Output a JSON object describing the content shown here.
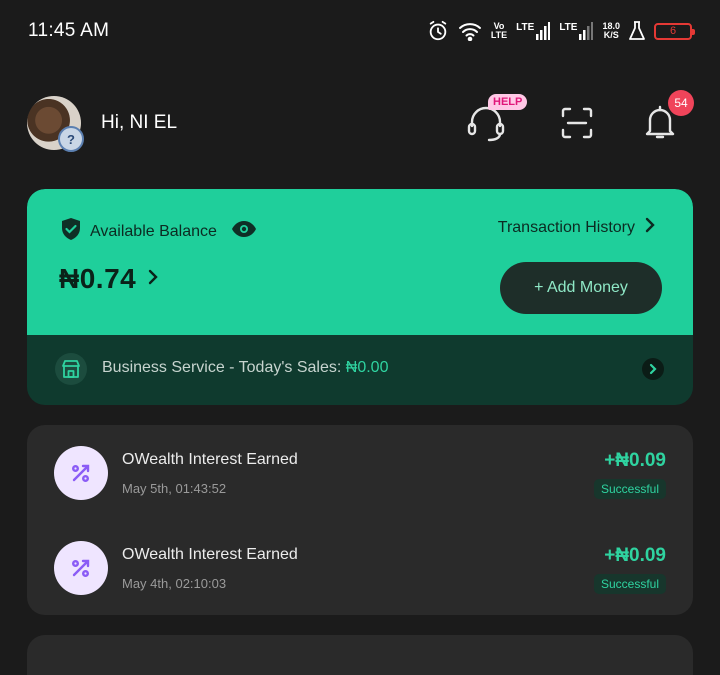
{
  "status_bar": {
    "time": "11:45 AM",
    "volte_top": "Vo",
    "volte_bottom": "LTE",
    "lte1": "LTE",
    "lte2": "LTE",
    "speed_value": "18.0",
    "speed_unit": "K/S",
    "battery_level": "6"
  },
  "header": {
    "greeting": "Hi, NI EL",
    "help_tag": "HELP",
    "notification_count": "54"
  },
  "balance": {
    "label": "Available Balance",
    "history_label": "Transaction History",
    "amount": "₦0.74",
    "add_money_label": "+ Add Money",
    "business_label": "Business Service - Today's Sales: ",
    "business_sales": "₦0.00"
  },
  "transactions": [
    {
      "title": "OWealth Interest Earned",
      "date": "May 5th, 01:43:52",
      "amount": "+₦0.09",
      "status": "Successful"
    },
    {
      "title": "OWealth Interest Earned",
      "date": "May 4th, 02:10:03",
      "amount": "+₦0.09",
      "status": "Successful"
    }
  ],
  "colors": {
    "accent_green": "#1fcf9b",
    "background": "#1b1b1b",
    "card": "#2a2a2a",
    "badge_red": "#f0445a",
    "help_pink": "#ffc8e6",
    "tx_icon_bg": "#efe5ff",
    "tx_icon_fg": "#8b5cf6"
  },
  "icons": {
    "alarm": "alarm-icon",
    "wifi": "wifi-icon",
    "signal": "signal-icon",
    "flask": "flask-icon",
    "headset": "headset-icon",
    "scan": "scan-icon",
    "bell": "bell-icon",
    "shield": "shield-check-icon",
    "eye": "eye-icon",
    "chevron": "chevron-right-icon",
    "store": "store-icon",
    "percent": "percent-icon"
  }
}
